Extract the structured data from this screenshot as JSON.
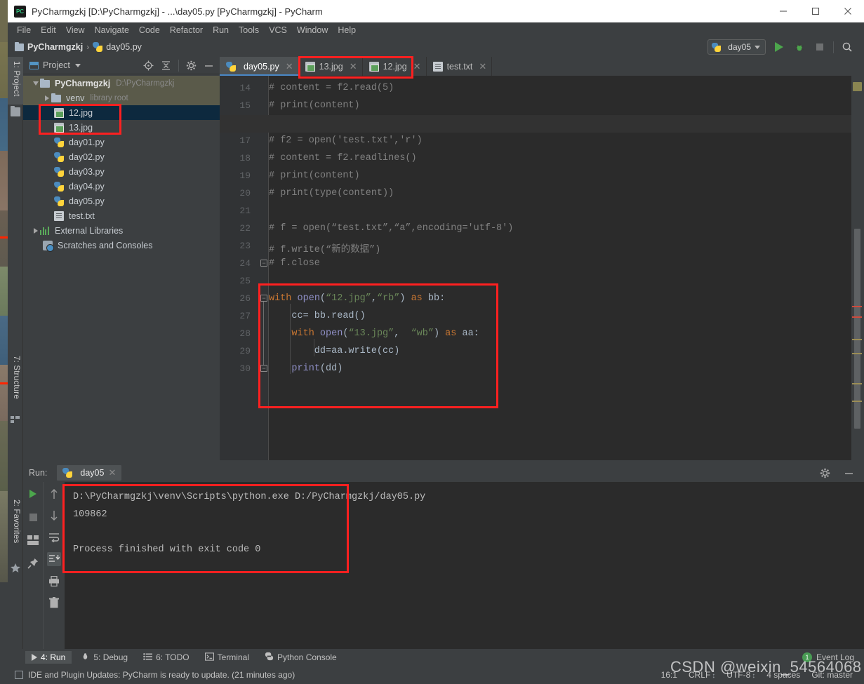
{
  "window": {
    "title": "PyCharmgzkj [D:\\PyCharmgzkj] - ...\\day05.py [PyCharmgzkj] - PyCharm",
    "app_icon": "pycharm-icon",
    "minimize_label": "minimize-icon",
    "maximize_label": "maximize-icon",
    "close_label": "close-icon"
  },
  "menubar": {
    "items": [
      {
        "label": "File"
      },
      {
        "label": "Edit"
      },
      {
        "label": "View"
      },
      {
        "label": "Navigate"
      },
      {
        "label": "Code"
      },
      {
        "label": "Refactor"
      },
      {
        "label": "Run"
      },
      {
        "label": "Tools"
      },
      {
        "label": "VCS"
      },
      {
        "label": "Window"
      },
      {
        "label": "Help"
      }
    ]
  },
  "navbar": {
    "project_name": "PyCharmgzkj",
    "separator": "›",
    "file_name": "day05.py",
    "run_config": "day05",
    "run_icon": "run-icon",
    "debug_icon": "debug-icon",
    "stop_icon": "stop-icon",
    "search_icon": "search-icon"
  },
  "left_strip": {
    "project_tab": "1: Project",
    "structure_tab": "7: Structure",
    "favorites_tab": "2: Favorites"
  },
  "project_panel": {
    "title": "Project",
    "locate_icon": "locate-icon",
    "collapse_icon": "collapse-all-icon",
    "settings_icon": "gear-icon",
    "hide_icon": "hide-icon",
    "tree": [
      {
        "label": "PyCharmgzkj",
        "note": "D:\\PyCharmgzkj",
        "icon": "folder-icon",
        "indent": 0,
        "arrow": "down",
        "style": "root"
      },
      {
        "label": "venv",
        "note": "library root",
        "icon": "folder-icon",
        "indent": 1,
        "arrow": "right",
        "style": "venv"
      },
      {
        "label": "12.jpg",
        "note": "",
        "icon": "image-file-icon",
        "indent": 2,
        "arrow": "none",
        "style": "selected"
      },
      {
        "label": "13.jpg",
        "note": "",
        "icon": "image-file-icon",
        "indent": 2,
        "arrow": "none",
        "style": "normal"
      },
      {
        "label": "day01.py",
        "note": "",
        "icon": "python-file-icon",
        "indent": 2,
        "arrow": "none",
        "style": "normal"
      },
      {
        "label": "day02.py",
        "note": "",
        "icon": "python-file-icon",
        "indent": 2,
        "arrow": "none",
        "style": "normal"
      },
      {
        "label": "day03.py",
        "note": "",
        "icon": "python-file-icon",
        "indent": 2,
        "arrow": "none",
        "style": "normal"
      },
      {
        "label": "day04.py",
        "note": "",
        "icon": "python-file-icon",
        "indent": 2,
        "arrow": "none",
        "style": "normal"
      },
      {
        "label": "day05.py",
        "note": "",
        "icon": "python-file-icon",
        "indent": 2,
        "arrow": "none",
        "style": "normal"
      },
      {
        "label": "test.txt",
        "note": "",
        "icon": "text-file-icon",
        "indent": 2,
        "arrow": "none",
        "style": "normal"
      },
      {
        "label": "External Libraries",
        "note": "",
        "icon": "library-icon",
        "indent": 0,
        "arrow": "right",
        "style": "normal"
      },
      {
        "label": "Scratches and Consoles",
        "note": "",
        "icon": "scratches-icon",
        "indent": 0,
        "arrow": "none",
        "style": "normal"
      }
    ]
  },
  "editor_tabs": [
    {
      "label": "day05.py",
      "icon": "python-file-icon",
      "active": true
    },
    {
      "label": "13.jpg",
      "icon": "image-file-icon",
      "active": false
    },
    {
      "label": "12.jpg",
      "icon": "image-file-icon",
      "active": false
    },
    {
      "label": "test.txt",
      "icon": "text-file-icon",
      "active": false
    }
  ],
  "editor": {
    "first_line": 14,
    "current_line": 16,
    "lines": [
      {
        "n": 14,
        "tokens": [
          {
            "t": "# content = f2.read(5)",
            "c": "cm"
          }
        ]
      },
      {
        "n": 15,
        "tokens": [
          {
            "t": "# print(content)",
            "c": "cm"
          }
        ]
      },
      {
        "n": 16,
        "tokens": [
          {
            "t": "",
            "c": "id"
          }
        ]
      },
      {
        "n": 17,
        "tokens": [
          {
            "t": "# f2 = open('test.txt','r')",
            "c": "cm"
          }
        ]
      },
      {
        "n": 18,
        "tokens": [
          {
            "t": "# content = f2.readlines()",
            "c": "cm"
          }
        ]
      },
      {
        "n": 19,
        "tokens": [
          {
            "t": "# print(content)",
            "c": "cm"
          }
        ]
      },
      {
        "n": 20,
        "tokens": [
          {
            "t": "# print(type(content))",
            "c": "cm"
          }
        ]
      },
      {
        "n": 21,
        "tokens": [
          {
            "t": "",
            "c": "id"
          }
        ]
      },
      {
        "n": 22,
        "tokens": [
          {
            "t": "# f = open(“test.txt”,“a”,encoding='utf-8')",
            "c": "cm"
          }
        ]
      },
      {
        "n": 23,
        "tokens": [
          {
            "t": "# f.write(“新的数据”)",
            "c": "cm"
          }
        ]
      },
      {
        "n": 24,
        "tokens": [
          {
            "t": "# f.close",
            "c": "cm"
          }
        ]
      },
      {
        "n": 25,
        "tokens": [
          {
            "t": "",
            "c": "id"
          }
        ]
      },
      {
        "n": 26,
        "tokens": [
          {
            "t": "with ",
            "c": "kw"
          },
          {
            "t": "open",
            "c": "fn"
          },
          {
            "t": "(",
            "c": "id"
          },
          {
            "t": "“12.jpg”",
            "c": "st"
          },
          {
            "t": ",",
            "c": "id"
          },
          {
            "t": "“rb”",
            "c": "st"
          },
          {
            "t": ") ",
            "c": "id"
          },
          {
            "t": "as ",
            "c": "kw"
          },
          {
            "t": "bb:",
            "c": "id"
          }
        ]
      },
      {
        "n": 27,
        "tokens": [
          {
            "t": "    cc= bb.read()",
            "c": "id"
          }
        ]
      },
      {
        "n": 28,
        "tokens": [
          {
            "t": "    ",
            "c": "id"
          },
          {
            "t": "with ",
            "c": "kw"
          },
          {
            "t": "open",
            "c": "fn"
          },
          {
            "t": "(",
            "c": "id"
          },
          {
            "t": "“13.jpg”",
            "c": "st"
          },
          {
            "t": ",  ",
            "c": "id"
          },
          {
            "t": "“wb”",
            "c": "st"
          },
          {
            "t": ") ",
            "c": "id"
          },
          {
            "t": "as ",
            "c": "kw"
          },
          {
            "t": "aa:",
            "c": "id"
          }
        ]
      },
      {
        "n": 29,
        "tokens": [
          {
            "t": "        dd=aa.write(cc)",
            "c": "id"
          }
        ]
      },
      {
        "n": 30,
        "tokens": [
          {
            "t": "    ",
            "c": "id"
          },
          {
            "t": "print",
            "c": "fn"
          },
          {
            "t": "(dd)",
            "c": "id"
          }
        ]
      }
    ]
  },
  "run_panel": {
    "label": "Run:",
    "tab_label": "day05",
    "tab_icon": "python-file-icon",
    "settings_icon": "gear-icon",
    "hide_icon": "hide-icon",
    "side_actions_a": [
      "rerun-icon",
      "stop-icon",
      "layout-icon",
      "pin-icon"
    ],
    "side_actions_b": [
      "up-icon",
      "down-icon",
      "soft-wrap-icon",
      "scroll-to-end-icon",
      "print-icon",
      "trash-icon"
    ],
    "console_lines": [
      "D:\\PyCharmgzkj\\venv\\Scripts\\python.exe D:/PyCharmgzkj/day05.py",
      "109862",
      "",
      "Process finished with exit code 0"
    ]
  },
  "bottom_bar": {
    "items": [
      {
        "label": "4: Run",
        "icon": "run-icon",
        "active": true
      },
      {
        "label": "5: Debug",
        "icon": "debug-icon",
        "active": false
      },
      {
        "label": "6: TODO",
        "icon": "todo-icon",
        "active": false
      },
      {
        "label": "Terminal",
        "icon": "terminal-icon",
        "active": false
      },
      {
        "label": "Python Console",
        "icon": "python-console-icon",
        "active": false
      }
    ],
    "event_log": "Event Log",
    "event_count": "1"
  },
  "status_bar": {
    "message": "IDE and Plugin Updates: PyCharm is ready to update. (21 minutes ago)",
    "caret_position": "16:1",
    "line_separator": "CRLF",
    "encoding": "UTF-8",
    "indent": "4 spaces",
    "branch": "Git: master"
  },
  "watermark": "CSDN @weixin_54564068",
  "colors": {
    "accent": "#4a88c7",
    "keyword": "#cc7832",
    "string": "#6a8759",
    "function": "#8f8fc6",
    "comment": "#808080",
    "annotation_red": "#ff2020",
    "editor_bg": "#2b2b2b",
    "chrome_bg": "#3c3f41"
  }
}
